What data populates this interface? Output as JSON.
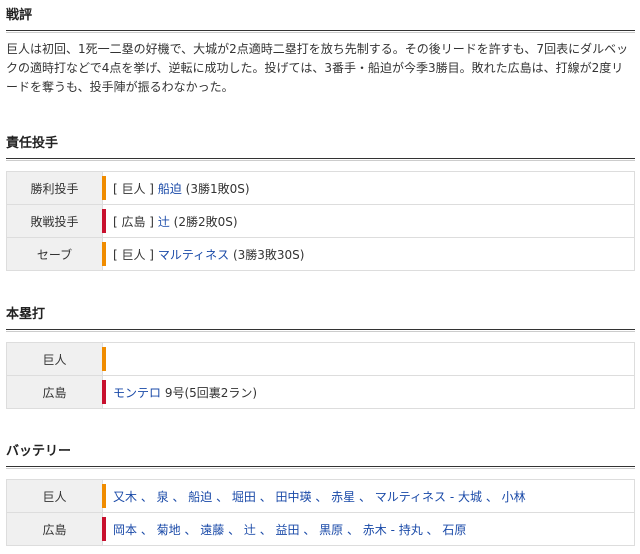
{
  "review": {
    "title": "戦評",
    "text": "巨人は初回、1死一二塁の好機で、大城が2点適時二塁打を放ち先制する。その後リードを許すも、7回表にダルベックの適時打などで4点を挙げ、逆転に成功した。投げては、3番手・船迫が今季3勝目。敗れた広島は、打線が2度リードを奪うも、投手陣が振るわなかった。"
  },
  "pitchers": {
    "title": "責任投手",
    "rows": [
      {
        "label": "勝利投手",
        "team": "[ 巨人 ]",
        "name": "船迫",
        "record": "(3勝1敗0S)",
        "color": "giants"
      },
      {
        "label": "敗戦投手",
        "team": "[ 広島 ]",
        "name": "辻",
        "record": "(2勝2敗0S)",
        "color": "carp"
      },
      {
        "label": "セーブ",
        "team": "[ 巨人 ]",
        "name": "マルティネス",
        "record": "(3勝3敗30S)",
        "color": "giants"
      }
    ]
  },
  "homeruns": {
    "title": "本塁打",
    "rows": [
      {
        "label": "巨人",
        "name": "",
        "detail": "",
        "color": "giants"
      },
      {
        "label": "広島",
        "name": "モンテロ",
        "detail": "9号(5回裏2ラン)",
        "color": "carp"
      }
    ]
  },
  "battery": {
    "title": "バッテリー",
    "rows": [
      {
        "label": "巨人",
        "line": "又木 、 泉 、 船迫 、 堀田 、 田中瑛 、 赤星 、 マルティネス  - 大城 、 小林",
        "color": "giants"
      },
      {
        "label": "広島",
        "line": "岡本 、 菊地 、 遠藤 、 辻 、 益田 、 黒原 、 赤木  - 持丸 、 石原",
        "color": "carp"
      }
    ]
  },
  "colors": {
    "giants": "#f08c00",
    "carp": "#c8102e",
    "link": "#1a4aa8"
  }
}
